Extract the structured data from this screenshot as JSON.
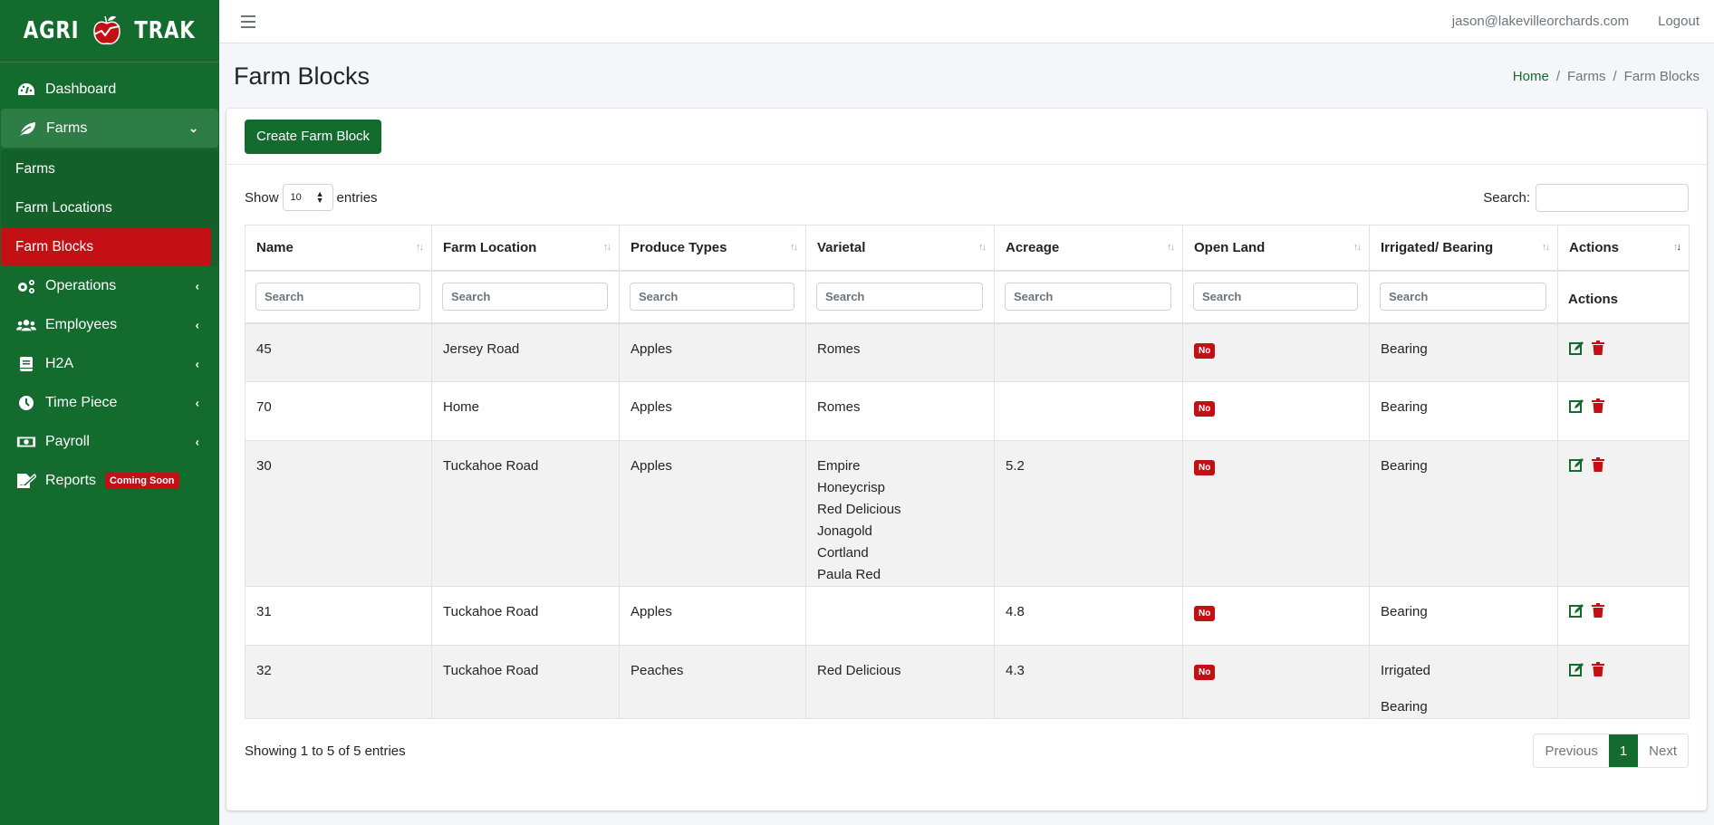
{
  "brand": {
    "left": "AGRI",
    "right": "TRAK"
  },
  "sidebar": {
    "items": [
      {
        "label": "Dashboard",
        "icon": "dashboard-gauge-icon"
      },
      {
        "label": "Farms",
        "icon": "leaf-icon",
        "open": true
      },
      {
        "label": "Operations",
        "icon": "cogs-icon"
      },
      {
        "label": "Employees",
        "icon": "users-icon"
      },
      {
        "label": "H2A",
        "icon": "book-icon"
      },
      {
        "label": "Time Piece",
        "icon": "clock-icon"
      },
      {
        "label": "Payroll",
        "icon": "money-bill-icon"
      },
      {
        "label": "Reports",
        "icon": "file-signature-icon",
        "badge": "Coming Soon"
      }
    ],
    "farms_sub": [
      {
        "label": "Farms"
      },
      {
        "label": "Farm Locations"
      },
      {
        "label": "Farm Blocks",
        "active": true
      }
    ]
  },
  "topbar": {
    "user": "jason@lakevilleorchards.com",
    "logout": "Logout"
  },
  "header": {
    "title": "Farm Blocks",
    "breadcrumb": [
      "Home",
      "Farms",
      "Farm Blocks"
    ]
  },
  "card": {
    "create_label": "Create Farm Block",
    "show_label": "Show",
    "entries_label": "entries",
    "page_length": "10",
    "search_label": "Search:",
    "search_value": ""
  },
  "table": {
    "columns": [
      "Name",
      "Farm Location",
      "Produce Types",
      "Varietal",
      "Acreage",
      "Open Land",
      "Irrigated/ Bearing",
      "Actions"
    ],
    "filter_placeholder": "Search",
    "filter_actions_label": "Actions",
    "rows": [
      {
        "name": "45",
        "location": "Jersey Road",
        "produce": "Apples",
        "varietal": [
          "Romes"
        ],
        "acreage": "",
        "open_land": "No",
        "irrigated_bearing": [
          "Bearing"
        ]
      },
      {
        "name": "70",
        "location": "Home",
        "produce": "Apples",
        "varietal": [
          "Romes"
        ],
        "acreage": "",
        "open_land": "No",
        "irrigated_bearing": [
          "Bearing"
        ]
      },
      {
        "name": "30",
        "location": "Tuckahoe Road",
        "produce": "Apples",
        "varietal": [
          "Empire",
          "Honeycrisp",
          "Red Delicious",
          "Jonagold",
          "Cortland",
          "Paula Red"
        ],
        "acreage": "5.2",
        "open_land": "No",
        "irrigated_bearing": [
          "Bearing"
        ]
      },
      {
        "name": "31",
        "location": "Tuckahoe Road",
        "produce": "Apples",
        "varietal": [],
        "acreage": "4.8",
        "open_land": "No",
        "irrigated_bearing": [
          "Bearing"
        ]
      },
      {
        "name": "32",
        "location": "Tuckahoe Road",
        "produce": "Peaches",
        "varietal": [
          "Red Delicious"
        ],
        "acreage": "4.3",
        "open_land": "No",
        "irrigated_bearing": [
          "Irrigated",
          "Bearing"
        ]
      }
    ]
  },
  "footer": {
    "info": "Showing 1 to 5 of 5 entries",
    "prev": "Previous",
    "page": "1",
    "next": "Next"
  },
  "colors": {
    "brand_green": "#146b2e",
    "accent_red": "#c21015"
  }
}
